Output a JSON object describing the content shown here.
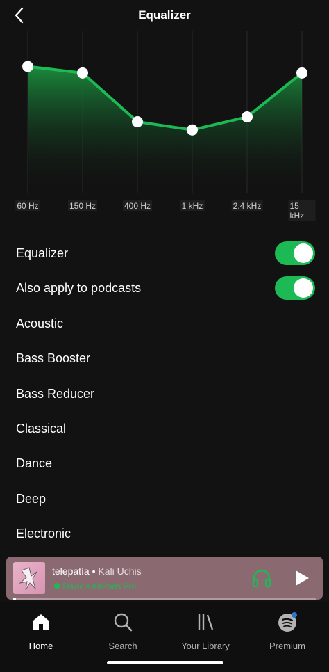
{
  "header": {
    "title": "Equalizer"
  },
  "equalizer": {
    "bands": [
      {
        "label": "60 Hz",
        "level": 0.78
      },
      {
        "label": "150 Hz",
        "level": 0.74
      },
      {
        "label": "400 Hz",
        "level": 0.44
      },
      {
        "label": "1 kHz",
        "level": 0.39
      },
      {
        "label": "2.4 kHz",
        "level": 0.47
      },
      {
        "label": "15 kHz",
        "level": 0.74
      }
    ],
    "color": "#1db954"
  },
  "settings": {
    "equalizer_label": "Equalizer",
    "equalizer_on": true,
    "podcasts_label": "Also apply to podcasts",
    "podcasts_on": true
  },
  "presets": [
    "Acoustic",
    "Bass Booster",
    "Bass Reducer",
    "Classical",
    "Dance",
    "Deep",
    "Electronic"
  ],
  "now_playing": {
    "title": "telepatía",
    "separator": " • ",
    "artist": "Kali Uchis",
    "device": "David's AirPods Pro",
    "progress": 0.01
  },
  "tabs": [
    {
      "label": "Home",
      "icon": "home-icon",
      "active": true
    },
    {
      "label": "Search",
      "icon": "search-icon",
      "active": false
    },
    {
      "label": "Your Library",
      "icon": "library-icon",
      "active": false
    },
    {
      "label": "Premium",
      "icon": "spotify-icon",
      "active": false
    }
  ]
}
